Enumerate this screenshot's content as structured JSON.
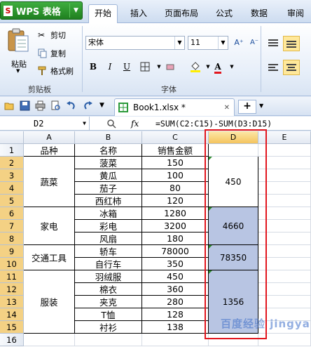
{
  "app": {
    "brand": "WPS 表格",
    "menu_tabs": [
      "开始",
      "插入",
      "页面布局",
      "公式",
      "数据",
      "审阅"
    ],
    "active_tab": "开始"
  },
  "ribbon": {
    "paste_label": "粘贴",
    "cut_label": "剪切",
    "copy_label": "复制",
    "format_painter_label": "格式刷",
    "clipboard_group": "剪贴板",
    "font_name": "宋体",
    "font_size": "11",
    "bold": "B",
    "italic": "I",
    "underline": "U",
    "font_group": "字体",
    "grow_font": "A⁺",
    "shrink_font": "A⁻",
    "accent_color": "#e2161e"
  },
  "quickbar": {
    "doc_tab": "Book1.xlsx *",
    "add_tab": "+"
  },
  "formula_bar": {
    "cell_ref": "D2",
    "fx": "fx",
    "formula": "=SUM(C2:C15)-SUM(D3:D15)"
  },
  "sheet": {
    "columns": [
      "A",
      "B",
      "C",
      "D",
      "E"
    ],
    "rows": [
      "1",
      "2",
      "3",
      "4",
      "5",
      "6",
      "7",
      "8",
      "9",
      "10",
      "11",
      "12",
      "13",
      "14",
      "15",
      "16"
    ],
    "header": [
      "品种",
      "名称",
      "销售金额"
    ],
    "categories": [
      {
        "label": "蔬菜"
      },
      {
        "label": "家电"
      },
      {
        "label": "交通工具"
      },
      {
        "label": "服装"
      }
    ],
    "names": [
      "菠菜",
      "黄瓜",
      "茄子",
      "西红柿",
      "冰箱",
      "彩电",
      "风扇",
      "轿车",
      "自行车",
      "羽绒服",
      "棉衣",
      "夹克",
      "T恤",
      "衬衫"
    ],
    "amounts": [
      "150",
      "100",
      "80",
      "120",
      "1280",
      "3200",
      "180",
      "78000",
      "350",
      "450",
      "360",
      "280",
      "128",
      "138"
    ],
    "subtotals": [
      "450",
      "4660",
      "78350",
      "1356"
    ]
  },
  "watermark": "百度经验 jingyan"
}
